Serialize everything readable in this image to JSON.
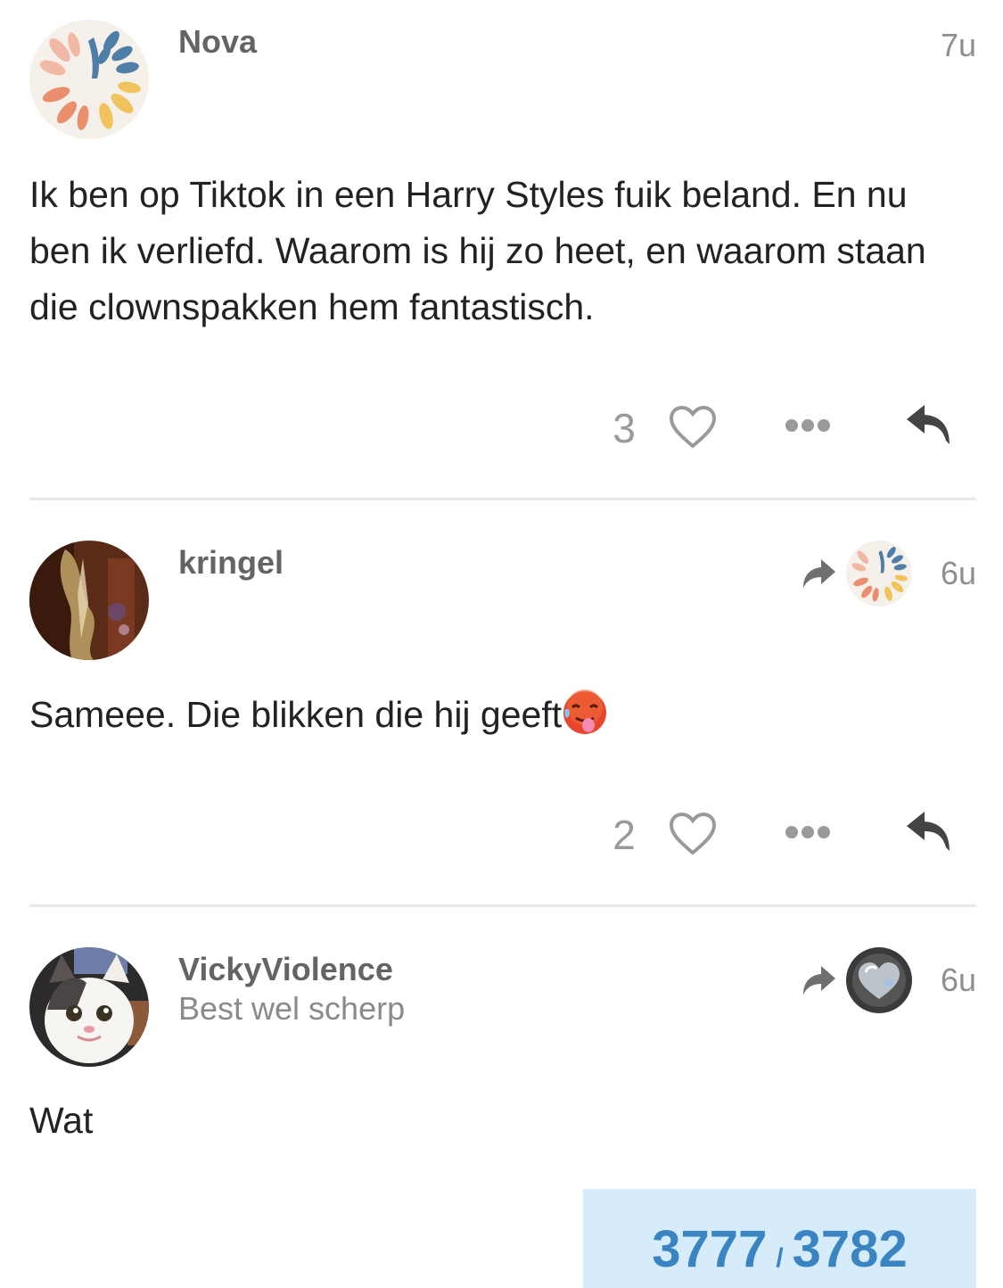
{
  "posts": [
    {
      "username": "Nova",
      "time": "7u",
      "text": "Ik ben op Tiktok in een Harry Styles fuik beland. En nu ben ik verliefd. Waarom is hij zo heet, en waarom staan die clownspakken hem fantastisch.",
      "likes": "3",
      "avatar_icon": "abstract-leaf-avatar"
    },
    {
      "username": "kringel",
      "time": "6u",
      "text": "Sameee. Die blikken die hij geeft",
      "emoji": "hot-face-emoji",
      "likes": "2",
      "reply_to_avatar": "abstract-leaf-avatar",
      "avatar_icon": "photo-avatar"
    },
    {
      "username": "VickyViolence",
      "user_title": "Best wel scherp",
      "time": "6u",
      "text": "Wat",
      "reply_to_avatar": "heart-bubble-avatar",
      "avatar_icon": "cat-avatar"
    }
  ],
  "progress": {
    "current": "3777",
    "separator": "/",
    "total": "3782"
  },
  "colors": {
    "progress_bg": "#d6ecfa",
    "progress_text": "#3a84c2",
    "username": "#646464",
    "muted": "#9a9a9a"
  }
}
